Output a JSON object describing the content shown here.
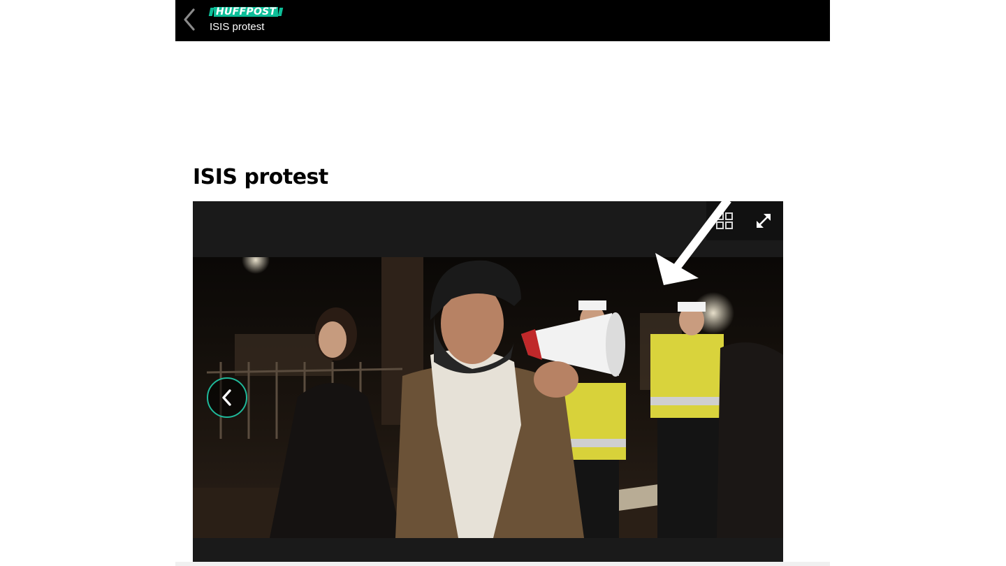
{
  "header": {
    "logo_text": "HUFFPOST",
    "title": "ISIS protest",
    "back_icon": "chevron-left-icon",
    "accent_color": "#0dbe98",
    "background_color": "#000000"
  },
  "page": {
    "title": "ISIS protest"
  },
  "slideshow": {
    "image": "protester-with-megaphone-photo",
    "grid_icon": "grid-icon",
    "fullscreen_icon": "fullscreen-icon",
    "prev_icon": "chevron-left-icon",
    "prev_button_border_color": "#1fb99a",
    "annotation": "white-arrow-icon"
  }
}
